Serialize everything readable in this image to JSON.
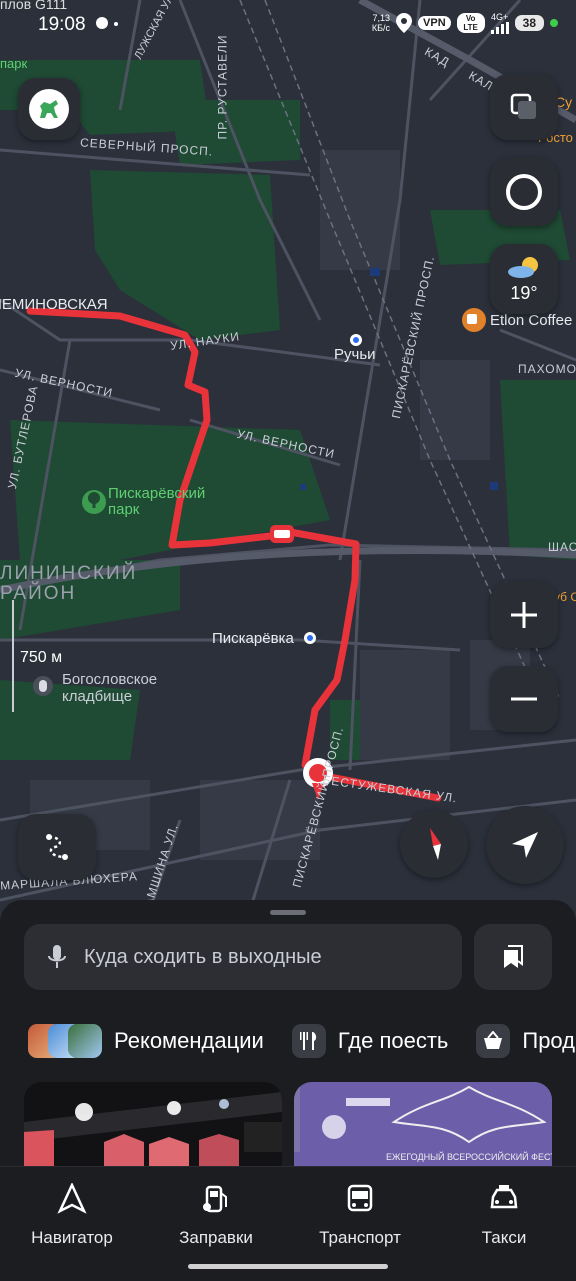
{
  "status_bar": {
    "carrier": "плов G111",
    "time": "19:08",
    "speed": "7,13",
    "speed_unit": "КБ/с",
    "vpn": "VPN",
    "volte": "Vo LTE",
    "network": "4G+",
    "battery": "38"
  },
  "map": {
    "streets": [
      "ЛУЖСКАЯ УЛ.",
      "ПР. РУСТАВЕЛИ",
      "СЕВЕРНЫЙ ПРОСП.",
      "ЛЕМИНОВСКАЯ",
      "УЛ. НАУКИ",
      "УЛ. ВЕРНОСТИ",
      "УЛ. ВЕРНОСТИ",
      "УЛ. БУТЛЕРОВА",
      "ПИСКАРЁВСКИЙ ПРОСП.",
      "ПАХОМОВ",
      "ШАС",
      "БЕСТУЖЕВСКАЯ УЛ.",
      "ПИСКАРЁВСКИЙ ПРОСП.",
      "АМШИНА УЛ.",
      "МАРШАЛА БЛЮХЕРА",
      "КАД",
      "КАЛ"
    ],
    "places": {
      "park": "Пискарёвский парк",
      "district": "ЛИНИНСКИЙ РАЙОН",
      "station_1": "Ручьи",
      "station_2": "Пискарёвка",
      "cemetery": "Богословское кладбище",
      "cafe": "Etlon Coffee",
      "park_top": "парк",
      "right_top": "Су",
      "right_top_2": "Росто",
      "right_mid": "Клуб С"
    },
    "weather_temp": "19°",
    "scale": "750 м"
  },
  "search": {
    "placeholder": "Куда сходить в выходные"
  },
  "categories": [
    {
      "label": "Рекомендации",
      "icon": "recommendations-icon"
    },
    {
      "label": "Где поесть",
      "icon": "fork-knife-icon"
    },
    {
      "label": "Прод",
      "icon": "basket-icon"
    }
  ],
  "cards": {
    "second_banner": "ЕЖЕГОДНЫЙ ВСЕРОССИЙСКИЙ ФЕСТИВАЛЬ"
  },
  "bottom_nav": [
    {
      "label": "Навигатор",
      "icon": "navigator-icon"
    },
    {
      "label": "Заправки",
      "icon": "fuel-icon"
    },
    {
      "label": "Транспорт",
      "icon": "bus-icon"
    },
    {
      "label": "Такси",
      "icon": "taxi-icon"
    }
  ],
  "colors": {
    "route": "#e8333a",
    "park": "#1f4a34",
    "map_bg": "#2b303b",
    "accent": "#2b6cf0"
  }
}
